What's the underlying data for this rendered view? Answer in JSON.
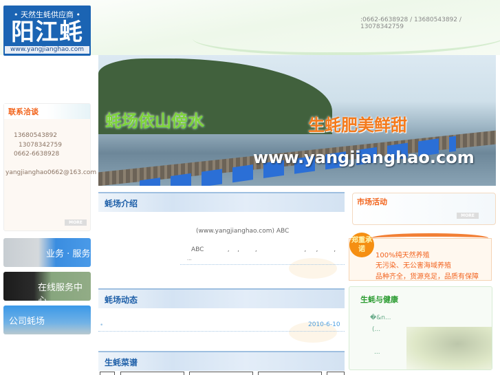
{
  "header": {
    "logo_tagline": "• 天然生蚝供应商 •",
    "logo_title": "阳江蚝",
    "logo_url": "www.yangjianghao.com",
    "phone": ":0662-6638928 / 13680543892 / 13078342759"
  },
  "banner": {
    "slogan_left": "蚝场依山傍水",
    "slogan_right": "生蚝肥美鲜甜",
    "url": "www.yangjianghao.com"
  },
  "contact": {
    "title": "联系洽谈",
    "phone1": "13680543892",
    "phone2": "13078342759",
    "phone3": "0662-6638928",
    "email": "yangjianghao0662@163.com",
    "more": "MORE"
  },
  "side_buttons": [
    {
      "label": "业务 · 服务"
    },
    {
      "label": "在线服务中心"
    },
    {
      "label": "公司蚝场"
    }
  ],
  "intro": {
    "title": "蚝场介绍",
    "line1": "(www.yangjianghao.com)    ABC",
    "line2": "ABC            ,    ,        ,                        ,     ,        ,",
    "line3": "..."
  },
  "news": {
    "title": "蚝场动态",
    "date": "2010-6-10"
  },
  "recipes": {
    "title": "生蚝菜谱"
  },
  "market": {
    "title": "市场活动",
    "more": "MORE"
  },
  "promise": {
    "badge": "郑重承诺",
    "items": [
      "100%纯天然养殖",
      "无污染、无公害海域养殖",
      "品种齐全，货源充足，品质有保障"
    ]
  },
  "health": {
    "title": "生蚝与健康",
    "items": [
      "�&n...",
      "(...",
      "..."
    ]
  }
}
